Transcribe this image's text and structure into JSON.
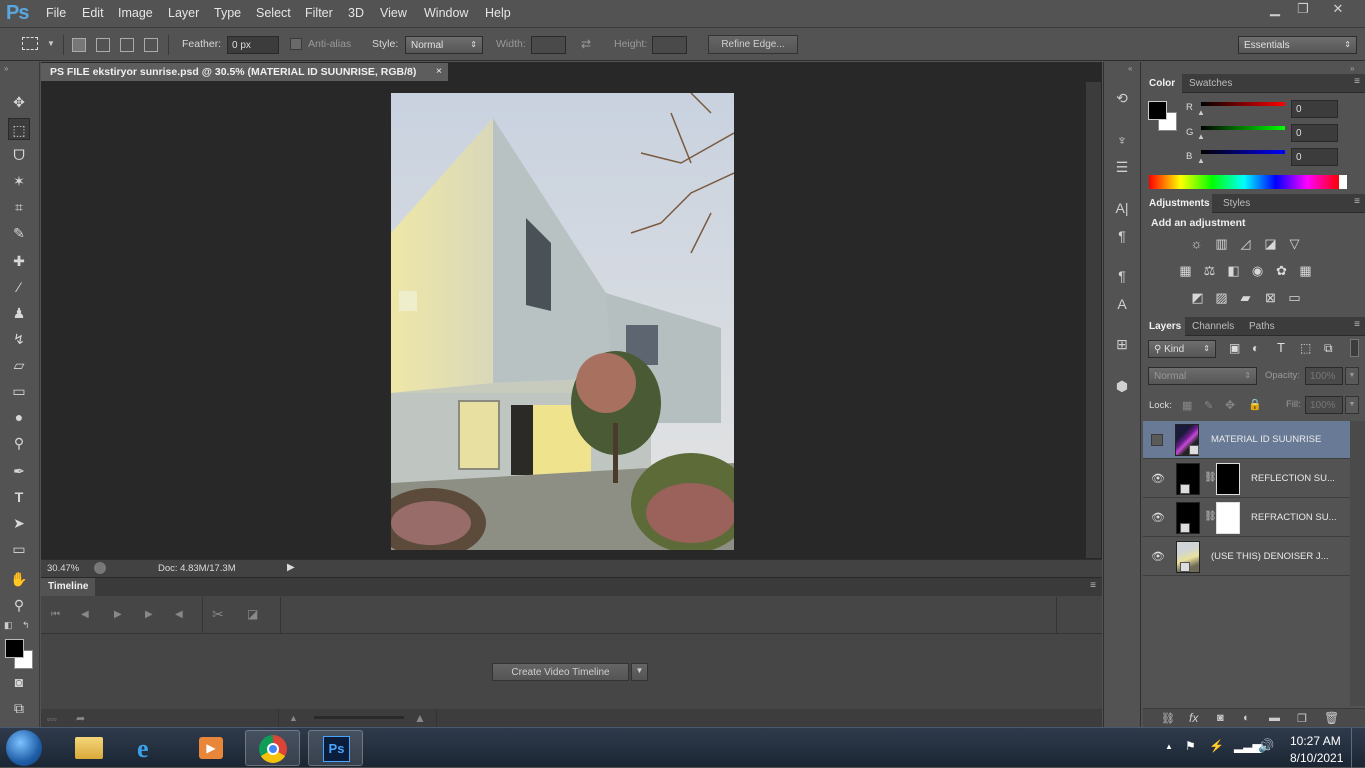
{
  "app": {
    "logo": "Ps"
  },
  "menu": [
    "File",
    "Edit",
    "Image",
    "Layer",
    "Type",
    "Select",
    "Filter",
    "3D",
    "View",
    "Window",
    "Help"
  ],
  "window_buttons": [
    "minimize-icon",
    "restore-icon",
    "close-icon"
  ],
  "options": {
    "feather_label": "Feather:",
    "feather_value": "0 px",
    "antialias_label": "Anti-alias",
    "style_label": "Style:",
    "style_value": "Normal",
    "width_label": "Width:",
    "height_label": "Height:",
    "refine_edge": "Refine Edge...",
    "workspace": "Essentials"
  },
  "document": {
    "tab_title": "PS FILE ekstiryor sunrise.psd @ 30.5% (MATERIAL ID SUUNRISE, RGB/8)",
    "close": "×",
    "zoom": "30.47%",
    "doc_size": "Doc: 4.83M/17.3M"
  },
  "timeline": {
    "title": "Timeline",
    "create_button": "Create Video Timeline"
  },
  "color_panel": {
    "tabs": [
      "Color",
      "Swatches"
    ],
    "r_label": "R",
    "g_label": "G",
    "b_label": "B",
    "r": "0",
    "g": "0",
    "b": "0",
    "foreground": "#000000",
    "background": "#ffffff"
  },
  "adjustments_panel": {
    "tabs": [
      "Adjustments",
      "Styles"
    ],
    "title": "Add an adjustment"
  },
  "layers_panel": {
    "tabs": [
      "Layers",
      "Channels",
      "Paths"
    ],
    "kind_filter": "Kind",
    "blend_mode": "Normal",
    "opacity_label": "Opacity:",
    "opacity": "100%",
    "lock_label": "Lock:",
    "fill_label": "Fill:",
    "fill": "100%",
    "layers": [
      {
        "name": "MATERIAL ID SUUNRISE",
        "visible": false,
        "selected": true
      },
      {
        "name": "REFLECTION SU...",
        "visible": true,
        "selected": false
      },
      {
        "name": "REFRACTION SU...",
        "visible": true,
        "selected": false
      },
      {
        "name": "(USE THIS) DENOISER J...",
        "visible": true,
        "selected": false
      }
    ]
  },
  "taskbar": {
    "time": "10:27 AM",
    "date": "8/10/2021",
    "apps": [
      "windows-start-icon",
      "file-explorer-icon",
      "internet-explorer-icon",
      "media-player-icon",
      "chrome-icon",
      "photoshop-icon"
    ]
  },
  "colors": {
    "panel": "#535353",
    "dark": "#282828",
    "accent": "#5aa7e0",
    "selected_layer": "#687a96"
  }
}
